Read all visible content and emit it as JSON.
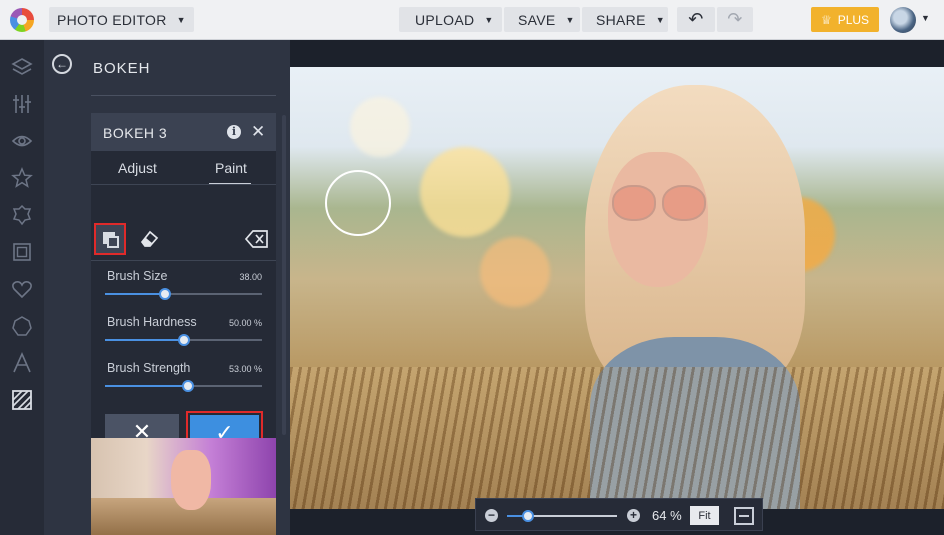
{
  "app": {
    "mode_label": "PHOTO EDITOR",
    "upload_label": "UPLOAD",
    "save_label": "SAVE",
    "share_label": "SHARE",
    "plus_label": "PLUS",
    "accent_color": "#3d8fe0",
    "highlight_color": "#e02a2a"
  },
  "rail": {
    "icons": [
      "layers-icon",
      "adjust-icon",
      "eye-icon",
      "star-icon",
      "frame-badge-icon",
      "frame-icon",
      "heart-icon",
      "shape-icon",
      "text-icon",
      "texture-icon"
    ]
  },
  "panel": {
    "title": "BOKEH",
    "card": {
      "title": "BOKEH 3",
      "tabs": {
        "adjust": "Adjust",
        "paint": "Paint",
        "active": "Paint"
      },
      "sliders": [
        {
          "label": "Brush Size",
          "value_text": "38.00",
          "level": 0.38
        },
        {
          "label": "Brush Hardness",
          "value_text": "50.00 %",
          "level": 0.5
        },
        {
          "label": "Brush Strength",
          "value_text": "53.00 %",
          "level": 0.53
        }
      ]
    }
  },
  "zoom": {
    "label": "64 %",
    "level": 0.19,
    "fit_label": "Fit"
  }
}
